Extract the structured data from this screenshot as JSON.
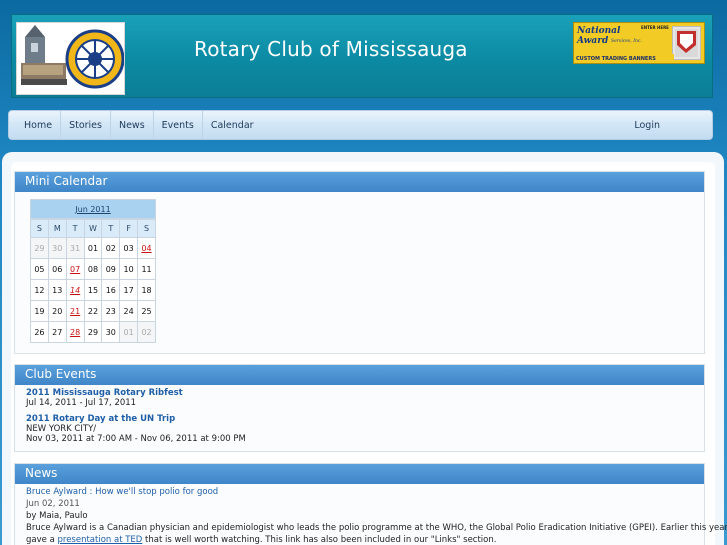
{
  "header": {
    "title": "Rotary Club of Mississauga",
    "banner": {
      "line1": "National",
      "line2": "Award",
      "small": "Services, Inc.",
      "enter": "ENTER HERE",
      "strip": "CUSTOM TRADING BANNERS"
    }
  },
  "nav": {
    "items": [
      "Home",
      "Stories",
      "News",
      "Events",
      "Calendar"
    ],
    "login": "Login"
  },
  "mini_calendar": {
    "heading": "Mini Calendar",
    "month": "Jun 2011",
    "weekdays": [
      "S",
      "M",
      "T",
      "W",
      "T",
      "F",
      "S"
    ],
    "weeks": [
      [
        "29",
        "30",
        "31",
        "01",
        "02",
        "03",
        "04"
      ],
      [
        "05",
        "06",
        "07",
        "08",
        "09",
        "10",
        "11"
      ],
      [
        "12",
        "13",
        "14",
        "15",
        "16",
        "17",
        "18"
      ],
      [
        "19",
        "20",
        "21",
        "22",
        "23",
        "24",
        "25"
      ],
      [
        "26",
        "27",
        "28",
        "29",
        "30",
        "01",
        "02"
      ]
    ]
  },
  "club_events": {
    "heading": "Club Events",
    "items": [
      {
        "title": "2011 Mississauga Rotary Ribfest",
        "location": "",
        "when": "Jul 14, 2011 - Jul 17, 2011"
      },
      {
        "title": "2011 Rotary Day at the UN Trip",
        "location": "NEW YORK CITY/",
        "when": "Nov 03, 2011 at 7:00 AM - Nov 06, 2011 at 9:00 PM"
      }
    ]
  },
  "news": {
    "heading": "News",
    "items": [
      {
        "title": "Bruce Aylward : How we'll stop polio for good",
        "date": "Jun 02, 2011",
        "by": "by Maia, Paulo",
        "body": "Bruce Aylward is a Canadian physician and epidemiologist who leads the polio programme at the WHO, the Global Polio Eradication Initiative (GPEI).  Earlier this year he",
        "body2_prefix": "gave a ",
        "body2_link": "presentation at TED",
        "body2_suffix": " that is well worth watching.  This link has also been included in our \"Links\" section."
      }
    ]
  }
}
